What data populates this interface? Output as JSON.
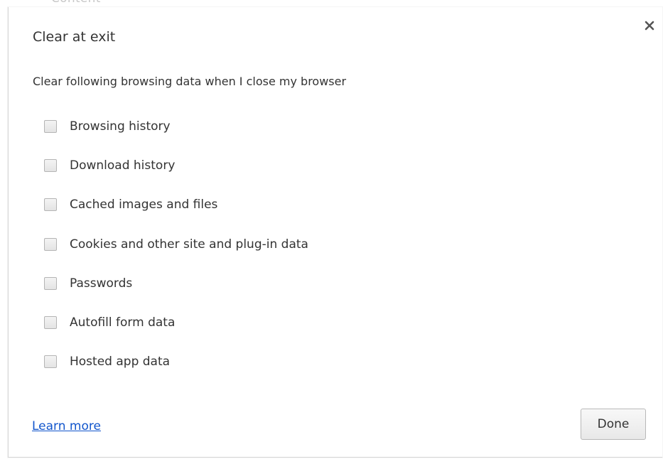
{
  "background": {
    "partial_text": "Content"
  },
  "dialog": {
    "title": "Clear at exit",
    "close_icon": "close-icon",
    "description": "Clear following browsing data when I close my browser",
    "options": [
      {
        "label": "Browsing history",
        "checked": false
      },
      {
        "label": "Download history",
        "checked": false
      },
      {
        "label": "Cached images and files",
        "checked": false
      },
      {
        "label": "Cookies and other site and plug-in data",
        "checked": false
      },
      {
        "label": "Passwords",
        "checked": false
      },
      {
        "label": "Autofill form data",
        "checked": false
      },
      {
        "label": "Hosted app data",
        "checked": false
      }
    ],
    "learn_more_label": "Learn more",
    "done_label": "Done"
  },
  "colors": {
    "link": "#1155cc",
    "text": "#333333"
  }
}
